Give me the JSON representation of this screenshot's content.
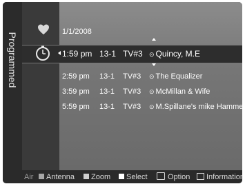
{
  "sidebar": {
    "title": "Programmed"
  },
  "schedule": {
    "date": "1/1/2008",
    "selected": {
      "time": "1:59 pm",
      "channel": "13-1",
      "source": "TV#3",
      "title": "Quincy, M.E"
    },
    "items": [
      {
        "time": "2:59 pm",
        "channel": "13-1",
        "source": "TV#3",
        "title": "The Equalizer"
      },
      {
        "time": "3:59 pm",
        "channel": "13-1",
        "source": "TV#3",
        "title": "McMillan & Wife"
      },
      {
        "time": "5:59 pm",
        "channel": "13-1",
        "source": "TV#3",
        "title": "M.Spillane's mike Hammer"
      }
    ]
  },
  "footer": {
    "source": "Air",
    "antenna": "Antenna",
    "zoom": "Zoom",
    "select": "Select",
    "option": "Option",
    "information": "Information"
  },
  "colors": {
    "antenna": "#a6a6a6",
    "zoom": "#d0d0d0",
    "select": "#ffffff"
  },
  "icons": {
    "favorite": "heart-icon",
    "timer": "timer-icon",
    "clock": "clock-icon",
    "option": "option-icon",
    "information": "information-icon"
  }
}
